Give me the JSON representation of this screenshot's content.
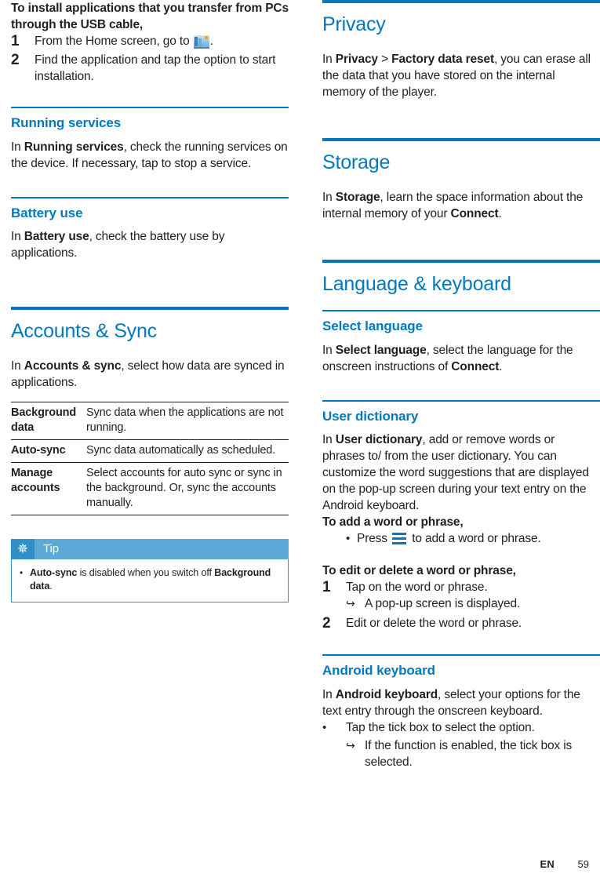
{
  "footer": {
    "language": "EN",
    "page_number": "59"
  },
  "colors": {
    "accent": "#0079bf",
    "tip_header": "#5aa9d6",
    "tip_icon_bg": "#2f8fc6",
    "text": "#231f20"
  },
  "left_column": {
    "install_apps": {
      "heading": "To install applications that you transfer from PCs through the USB cable,",
      "steps": [
        {
          "number": "1",
          "text_before": "From the Home screen, go to ",
          "icon": "apps-icon",
          "text_after": "."
        },
        {
          "number": "2",
          "text_before": "Find the application and tap the option to start installation.",
          "icon": "",
          "text_after": ""
        }
      ]
    },
    "running_services": {
      "heading": "Running services",
      "body_parts": [
        {
          "text": "In ",
          "bold": false
        },
        {
          "text": "Running services",
          "bold": true
        },
        {
          "text": ", check the running services on the device. If necessary, tap to stop a service.",
          "bold": false
        }
      ]
    },
    "battery_use": {
      "heading": "Battery use",
      "body_parts": [
        {
          "text": "In ",
          "bold": false
        },
        {
          "text": "Battery use",
          "bold": true
        },
        {
          "text": ", check the battery use by applications.",
          "bold": false
        }
      ]
    },
    "accounts_sync": {
      "heading": "Accounts & Sync",
      "body_parts": [
        {
          "text": "In ",
          "bold": false
        },
        {
          "text": "Accounts & sync",
          "bold": true
        },
        {
          "text": ", select how data are synced in applications.",
          "bold": false
        }
      ],
      "table": {
        "rows": [
          {
            "key": "Background data",
            "value": "Sync data when the applications are not running."
          },
          {
            "key": "Auto-sync",
            "value": "Sync data automatically as scheduled."
          },
          {
            "key": "Manage accounts",
            "value": "Select accounts for auto sync or sync in the background. Or, sync the accounts manually."
          }
        ]
      },
      "tip": {
        "icon": "asterisk-icon",
        "label": "Tip",
        "bullet_parts": [
          {
            "text": "Auto-sync",
            "bold": true
          },
          {
            "text": " is disabled when you switch off ",
            "bold": false
          },
          {
            "text": "Background data",
            "bold": true
          },
          {
            "text": ".",
            "bold": false
          }
        ]
      }
    }
  },
  "right_column": {
    "privacy": {
      "heading": "Privacy",
      "body_parts": [
        {
          "text": "In ",
          "bold": false
        },
        {
          "text": "Privacy",
          "bold": true
        },
        {
          "text": " > ",
          "bold": false
        },
        {
          "text": "Factory data reset",
          "bold": true
        },
        {
          "text": ", you can erase all the data that you have stored on the internal memory of the player.",
          "bold": false
        }
      ]
    },
    "storage": {
      "heading": "Storage",
      "body_parts": [
        {
          "text": "In ",
          "bold": false
        },
        {
          "text": "Storage",
          "bold": true
        },
        {
          "text": ", learn the space information about the internal memory of your ",
          "bold": false
        },
        {
          "text": "Connect",
          "bold": true
        },
        {
          "text": ".",
          "bold": false
        }
      ]
    },
    "language_keyboard": {
      "heading": "Language & keyboard",
      "select_language": {
        "heading": "Select language",
        "body_parts": [
          {
            "text": "In ",
            "bold": false
          },
          {
            "text": "Select language",
            "bold": true
          },
          {
            "text": ", select the language for the onscreen instructions of ",
            "bold": false
          },
          {
            "text": "Connect",
            "bold": true
          },
          {
            "text": ".",
            "bold": false
          }
        ]
      },
      "user_dictionary": {
        "heading": "User dictionary",
        "body_parts": [
          {
            "text": "In ",
            "bold": false
          },
          {
            "text": "User dictionary",
            "bold": true
          },
          {
            "text": ", add or remove words or phrases to/ from the user dictionary. You can customize the word suggestions that are displayed on the pop-up screen during your text entry on the Android keyboard.",
            "bold": false
          }
        ],
        "add_lead": "To add a word or phrase,",
        "add_bullet_before": "Press ",
        "add_bullet_icon": "menu-icon",
        "add_bullet_after": " to add a word or phrase.",
        "edit_lead": "To edit or delete a word or phrase,",
        "edit_steps": [
          {
            "number": "1",
            "text": "Tap on the word or phrase.",
            "sub": "A pop-up screen is displayed."
          },
          {
            "number": "2",
            "text": "Edit or delete the word or phrase.",
            "sub": ""
          }
        ]
      },
      "android_keyboard": {
        "heading": "Android keyboard",
        "body_parts": [
          {
            "text": "In ",
            "bold": false
          },
          {
            "text": "Android keyboard",
            "bold": true
          },
          {
            "text": ", select your options for the text entry through the onscreen keyboard.",
            "bold": false
          }
        ],
        "bullet": "Tap the tick box to select the option.",
        "sub_bullet": "If the function is enabled, the tick box is selected."
      }
    }
  }
}
